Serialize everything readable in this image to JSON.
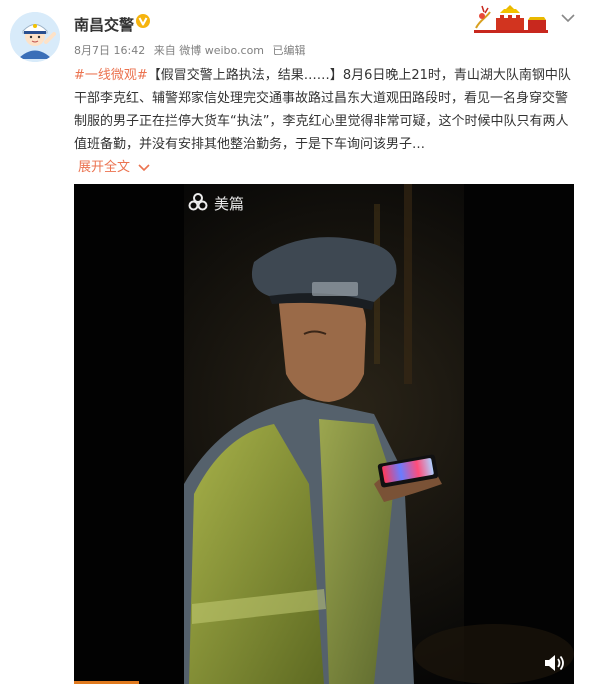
{
  "post": {
    "author": "南昌交警",
    "date": "8月7日 16:42",
    "source": "来自 微博 weibo.com",
    "edited": "已编辑",
    "topic": "#一线微观#",
    "title": "【假冒交警上路执法，结果……】",
    "body": "8月6日晚上21时，青山湖大队南钢中队干部李克红、辅警郑家信处理完交通事故路过昌东大道观田路段时，看见一名身穿交警制服的男子正在拦停大货车“执法”，李克红心里觉得非常可疑，这个时候中队只有两人值班备勤，并没有安排其他整治勤务，于是下车询问该男子…",
    "expand_label": "展开全文"
  },
  "video": {
    "watermark": "美篇",
    "progress": 0.13
  },
  "colors": {
    "link": "#eb7350",
    "meta": "#808080",
    "badge": "#f6b40e"
  },
  "icons": {
    "verified": "verified-v-badge-icon",
    "menu": "chevron-down-icon",
    "volume": "speaker-icon",
    "watermark": "meipian-logo-icon"
  }
}
